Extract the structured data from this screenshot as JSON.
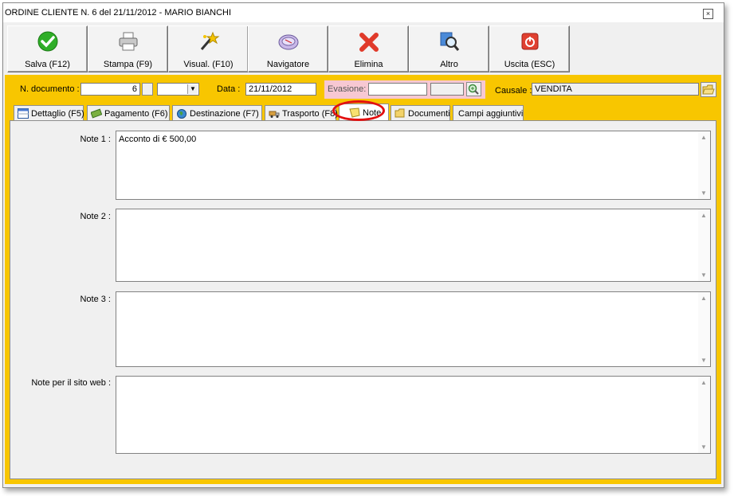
{
  "window": {
    "title": "ORDINE CLIENTE N. 6  del 21/11/2012 - MARIO BIANCHI"
  },
  "toolbar": {
    "buttons": [
      {
        "label": "Salva (F12)",
        "icon": "check-icon"
      },
      {
        "label": "Stampa (F9)",
        "icon": "printer-icon"
      },
      {
        "label": "Visual. (F10)",
        "icon": "magic-wand-icon"
      },
      {
        "label": "Navigatore",
        "icon": "compass-icon"
      },
      {
        "label": "Elimina",
        "icon": "delete-x-icon"
      },
      {
        "label": "Altro",
        "icon": "magnifier-icon"
      },
      {
        "label": "Uscita (ESC)",
        "icon": "power-icon"
      }
    ]
  },
  "header": {
    "doc_number_label": "N. documento :",
    "doc_number_value": "6",
    "series_value": "",
    "date_label": "Data :",
    "date_value": "21/11/2012",
    "evasione_label": "Evasione:",
    "evasione_value": "",
    "evasione_extra": "",
    "causale_label": "Causale :",
    "causale_value": "VENDITA"
  },
  "tabs": [
    {
      "label": "Dettaglio (F5)",
      "icon": "table-icon"
    },
    {
      "label": "Pagamento (F6)",
      "icon": "money-icon"
    },
    {
      "label": "Destinazione (F7)",
      "icon": "globe-icon"
    },
    {
      "label": "Trasporto (F8)",
      "icon": "truck-icon"
    },
    {
      "label": "Note",
      "icon": "sticky-note-icon",
      "active": true
    },
    {
      "label": "Documenti",
      "icon": "folder-icon"
    },
    {
      "label": "Campi aggiuntivi"
    }
  ],
  "notes": {
    "note1_label": "Note 1 :",
    "note1_value": "Acconto di  € 500,00",
    "note2_label": "Note 2 :",
    "note2_value": "",
    "note3_label": "Note 3 :",
    "note3_value": "",
    "web_label": "Note per il sito web :",
    "web_value": ""
  },
  "colors": {
    "panel": "#f8c600",
    "evasione_bg": "#f7c8d2",
    "highlight": "#e21010"
  }
}
